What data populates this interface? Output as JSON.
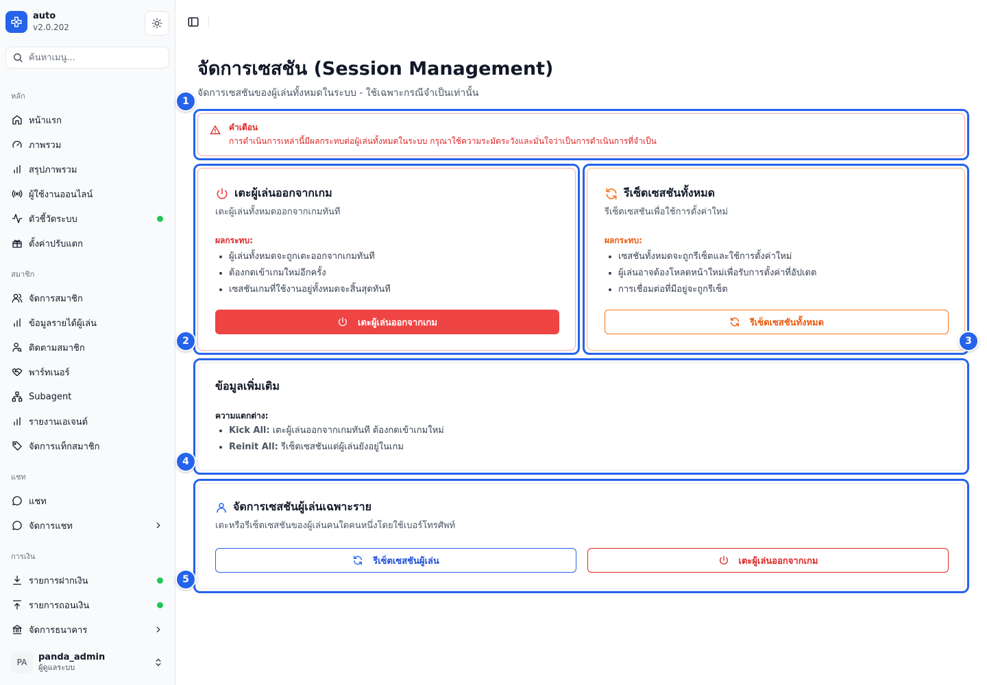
{
  "app": {
    "name": "auto",
    "version": "v2.0.202"
  },
  "search": {
    "placeholder": "ค้นหาเมนู..."
  },
  "sidebar": {
    "groups": [
      {
        "label": "หลัก",
        "items": [
          {
            "label": "หน้าแรก",
            "icon": "home-icon"
          },
          {
            "label": "ภาพรวม",
            "icon": "gauge-icon"
          },
          {
            "label": "สรุปภาพรวม",
            "icon": "bar-chart-icon"
          },
          {
            "label": "ผู้ใช้งานออนไลน์",
            "icon": "broadcast-icon"
          },
          {
            "label": "ตัวชี้วัดระบบ",
            "icon": "activity-icon",
            "status_dot": true
          },
          {
            "label": "ตั้งค่าปรับแตก",
            "icon": "gift-icon"
          }
        ]
      },
      {
        "label": "สมาชิก",
        "items": [
          {
            "label": "จัดการสมาชิก",
            "icon": "users-icon"
          },
          {
            "label": "ข้อมูลรายได้ผู้เล่น",
            "icon": "bar-chart-icon"
          },
          {
            "label": "ติดตามสมาชิก",
            "icon": "user-search-icon"
          },
          {
            "label": "พาร์ทเนอร์",
            "icon": "handshake-icon"
          },
          {
            "label": "Subagent",
            "icon": "network-icon"
          },
          {
            "label": "รายงานเอเจนต์",
            "icon": "bar-chart-icon"
          },
          {
            "label": "จัดการแท็กสมาชิก",
            "icon": "tag-icon"
          }
        ]
      },
      {
        "label": "แชท",
        "items": [
          {
            "label": "แชท",
            "icon": "chat-icon"
          },
          {
            "label": "จัดการแชท",
            "icon": "chat-icon",
            "has_submenu": true
          }
        ]
      },
      {
        "label": "การเงิน",
        "items": [
          {
            "label": "รายการฝากเงิน",
            "icon": "download-icon",
            "status_dot": true
          },
          {
            "label": "รายการถอนเงิน",
            "icon": "upload-icon",
            "status_dot": true
          },
          {
            "label": "จัดการธนาคาร",
            "icon": "bank-icon",
            "has_submenu": true
          }
        ]
      }
    ]
  },
  "user": {
    "initials": "PA",
    "name": "panda_admin",
    "role": "ผู้ดูแลระบบ"
  },
  "page": {
    "title": "จัดการเซสชัน (Session Management)",
    "subtitle": "จัดการเซสชันของผู้เล่นทั้งหมดในระบบ - ใช้เฉพาะกรณีจำเป็นเท่านั้น"
  },
  "alert": {
    "title": "คำเตือน",
    "text": "การดำเนินการเหล่านี้มีผลกระทบต่อผู้เล่นทั้งหมดในระบบ กรุณาใช้ความระมัดระวังและมั่นใจว่าเป็นการดำเนินการที่จำเป็น"
  },
  "kick_card": {
    "title": "เตะผู้เล่นออกจากเกม",
    "desc": "เตะผู้เล่นทั้งหมดออกจากเกมทันที",
    "effect_label": "ผลกระทบ:",
    "effects": [
      "ผู้เล่นทั้งหมดจะถูกเตะออกจากเกมทันที",
      "ต้องกดเข้าเกมใหม่อีกครั้ง",
      "เซสชันเกมที่ใช้งานอยู่ทั้งหมดจะสิ้นสุดทันที"
    ],
    "button": "เตะผู้เล่นออกจากเกม"
  },
  "reset_card": {
    "title": "รีเซ็ตเซสชันทั้งหมด",
    "desc": "รีเซ็ตเซสชันเพื่อใช้การตั้งค่าใหม่",
    "effect_label": "ผลกระทบ:",
    "effects": [
      "เซสชันทั้งหมดจะถูกรีเซ็ตและใช้การตั้งค่าใหม่",
      "ผู้เล่นอาจต้องโหลดหน้าใหม่เพื่อรับการตั้งค่าที่อัปเดต",
      "การเชื่อมต่อที่มีอยู่จะถูกรีเซ็ต"
    ],
    "button": "รีเซ็ตเซสชันทั้งหมด"
  },
  "info_card": {
    "title": "ข้อมูลเพิ่มเติม",
    "subtitle": "ความแตกต่าง:",
    "items": [
      {
        "term": "Kick All:",
        "text": " เตะผู้เล่นออกจากเกมทันที ต้องกดเข้าเกมใหม่"
      },
      {
        "term": "Reinit All:",
        "text": " รีเซ็ตเซสชันแต่ผู้เล่นยังอยู่ในเกม"
      }
    ]
  },
  "player_card": {
    "title": "จัดการเซสชันผู้เล่นเฉพาะราย",
    "desc": "เตะหรือรีเซ็ตเซสชันของผู้เล่นคนใดคนหนึ่งโดยใช้เบอร์โทรศัพท์",
    "reset_button": "รีเซ็ตเซสชันผู้เล่น",
    "kick_button": "เตะผู้เล่นออกจากเกม"
  },
  "annotations": [
    "1",
    "2",
    "3",
    "4",
    "5"
  ],
  "colors": {
    "accent": "#2563eb",
    "danger": "#ef4444",
    "warning": "#ea580c",
    "online": "#22c55e"
  }
}
